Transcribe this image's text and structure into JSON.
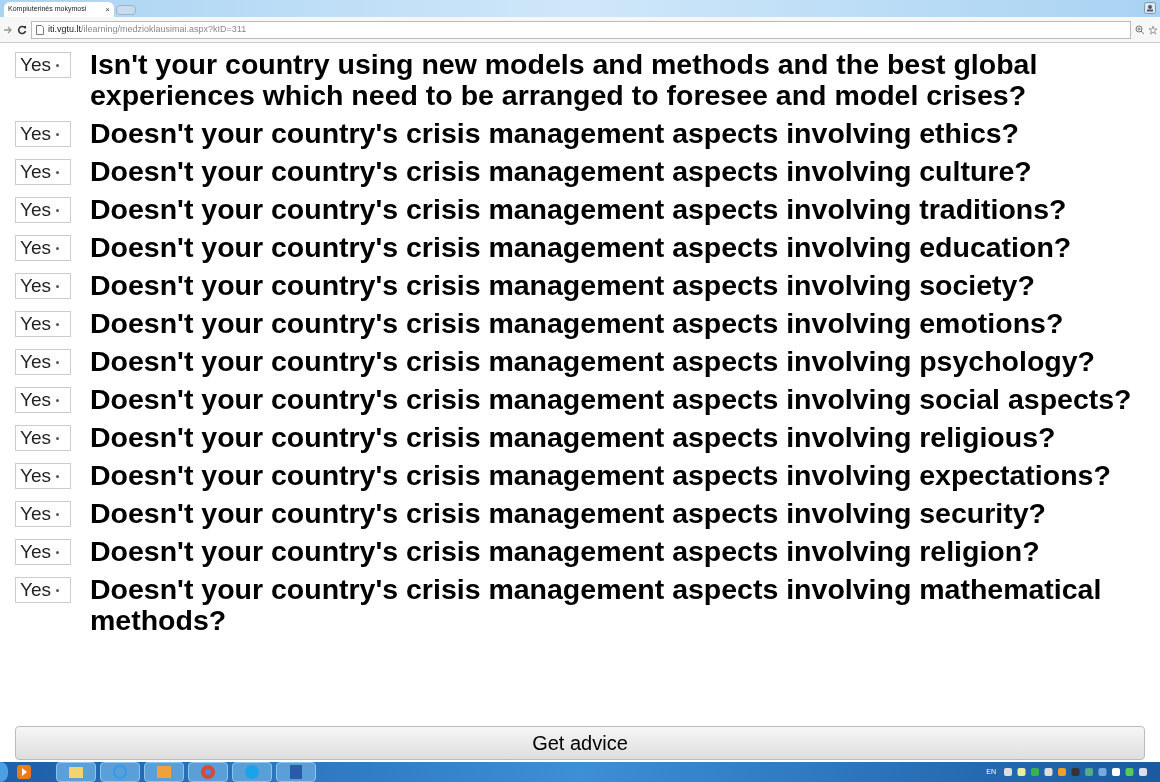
{
  "browser": {
    "tab_title": "Kompiuterinės mokymosi",
    "tab_close": "×",
    "url_host": "iti.vgtu.lt",
    "url_path": "/ilearning/medzioklausimai.aspx?kID=311"
  },
  "questions": [
    {
      "answer": "Yes",
      "text": "Isn't your country using new models and methods and the best global experiences which need to be arranged to foresee and model crises?"
    },
    {
      "answer": "Yes",
      "text": "Doesn't your country's crisis management aspects involving ethics?"
    },
    {
      "answer": "Yes",
      "text": "Doesn't your country's crisis management aspects involving culture?"
    },
    {
      "answer": "Yes",
      "text": "Doesn't your country's crisis management aspects involving traditions?"
    },
    {
      "answer": "Yes",
      "text": "Doesn't your country's crisis management aspects involving education?"
    },
    {
      "answer": "Yes",
      "text": "Doesn't your country's crisis management aspects involving society?"
    },
    {
      "answer": "Yes",
      "text": "Doesn't your country's crisis management aspects involving emotions?"
    },
    {
      "answer": "Yes",
      "text": "Doesn't your country's crisis management aspects involving psychology?"
    },
    {
      "answer": "Yes",
      "text": "Doesn't your country's crisis management aspects involving social aspects?"
    },
    {
      "answer": "Yes",
      "text": "Doesn't your country's crisis management aspects involving religious?"
    },
    {
      "answer": "Yes",
      "text": "Doesn't your country's crisis management aspects involving expectations?"
    },
    {
      "answer": "Yes",
      "text": "Doesn't your country's crisis management aspects involving security?"
    },
    {
      "answer": "Yes",
      "text": "Doesn't your country's crisis management aspects involving religion?"
    },
    {
      "answer": "Yes",
      "text": "Doesn't your country's crisis management aspects involving mathematical methods?"
    }
  ],
  "submit_button": "Get advice",
  "taskbar": {
    "language": "EN"
  }
}
